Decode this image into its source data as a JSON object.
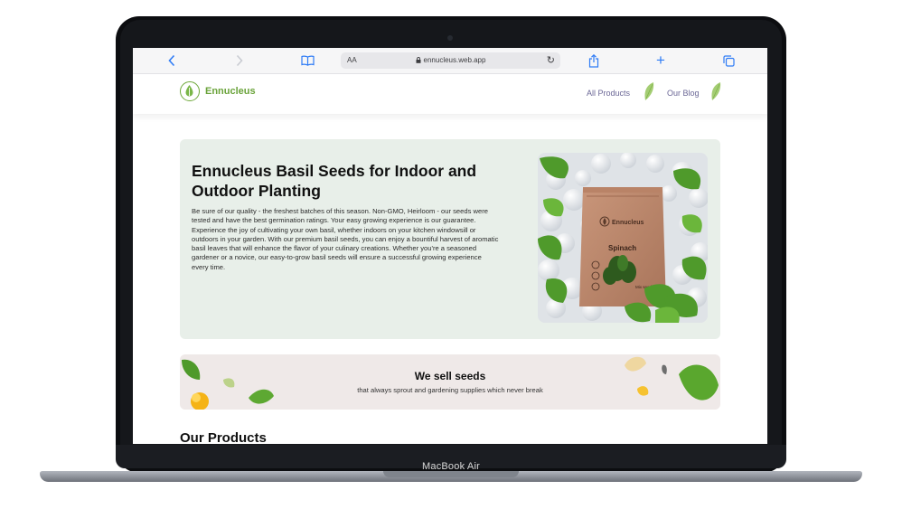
{
  "device": {
    "label": "MacBook Air"
  },
  "browser": {
    "address_prefix": "AA",
    "url": "ennucleus.web.app",
    "icons": {
      "back": "chevron-left-icon",
      "forward": "chevron-right-icon",
      "bookmarks": "book-icon",
      "reload": "reload-icon",
      "share": "share-icon",
      "new_tab": "plus-icon",
      "tabs": "tabs-icon"
    }
  },
  "site": {
    "logo_text": "Ennucleus",
    "nav": [
      {
        "label": "All Products"
      },
      {
        "label": "Our Blog"
      }
    ],
    "colors": {
      "brand_green": "#6aa33a",
      "nav_text": "#6b6796",
      "hero_bg": "#e8efe9",
      "banner_bg": "#efe9e8"
    }
  },
  "hero": {
    "title": "Ennucleus Basil Seeds for Indoor and Outdoor Planting",
    "paragraph1": "Be sure of our quality - the freshest batches of this season. Non-GMO, Heirloom - our seeds were tested and have the best germination ratings. Your easy growing experience is our guarantee.",
    "paragraph2": "Experience the joy of cultivating your own basil, whether indoors on your kitchen windowsill or outdoors in your garden. With our premium basil seeds, you can enjoy a bountiful harvest of aromatic basil leaves that will enhance the flavor of your culinary creations. Whether you're a seasoned gardener or a novice, our easy-to-grow basil seeds will ensure a successful growing experience every time.",
    "package": {
      "brand": "Ennucleus",
      "name": "Spinach",
      "small_text": "Mix seeds"
    }
  },
  "banner": {
    "title": "We sell seeds",
    "subtitle": "that always sprout and gardening supplies which never break"
  },
  "section": {
    "title": "Our Products"
  }
}
